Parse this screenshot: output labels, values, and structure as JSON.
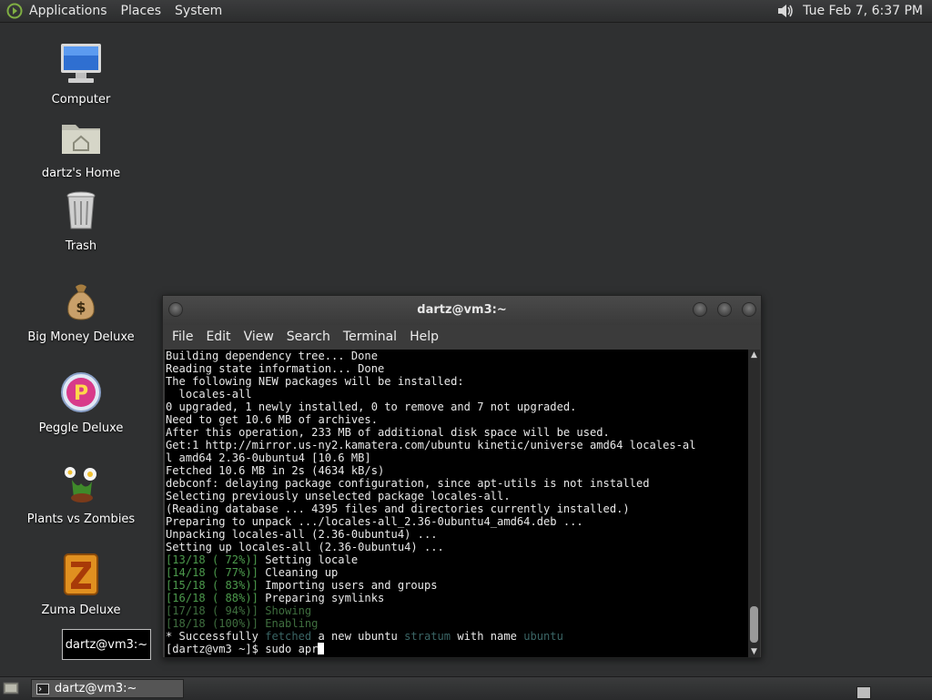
{
  "top_panel": {
    "menus": [
      "Applications",
      "Places",
      "System"
    ],
    "clock": "Tue Feb  7,  6:37 PM"
  },
  "desktop_icons": [
    {
      "label": "Computer",
      "icon": "computer-icon"
    },
    {
      "label": "dartz's Home",
      "icon": "home-folder-icon"
    },
    {
      "label": "Trash",
      "icon": "trash-icon"
    },
    {
      "label": "Big Money Deluxe",
      "icon": "money-bag-icon"
    },
    {
      "label": "Peggle Deluxe",
      "icon": "peggle-icon"
    },
    {
      "label": "Plants vs Zombies",
      "icon": "plants-icon"
    },
    {
      "label": "Zuma Deluxe",
      "icon": "zuma-icon"
    }
  ],
  "tooltip": "dartz@vm3:~",
  "terminal": {
    "title": "dartz@vm3:~",
    "menu": [
      "File",
      "Edit",
      "View",
      "Search",
      "Terminal",
      "Help"
    ],
    "lines": [
      "Building dependency tree... Done",
      "Reading state information... Done",
      "The following NEW packages will be installed:",
      "  locales-all",
      "0 upgraded, 1 newly installed, 0 to remove and 7 not upgraded.",
      "Need to get 10.6 MB of archives.",
      "After this operation, 233 MB of additional disk space will be used.",
      "Get:1 http://mirror.us-ny2.kamatera.com/ubuntu kinetic/universe amd64 locales-al",
      "l amd64 2.36-0ubuntu4 [10.6 MB]",
      "Fetched 10.6 MB in 2s (4634 kB/s)",
      "debconf: delaying package configuration, since apt-utils is not installed",
      "Selecting previously unselected package locales-all.",
      "(Reading database ... 4395 files and directories currently installed.)",
      "Preparing to unpack .../locales-all_2.36-0ubuntu4_amd64.deb ...",
      "Unpacking locales-all (2.36-0ubuntu4) ...",
      "Setting up locales-all (2.36-0ubuntu4) ..."
    ],
    "progress": [
      {
        "prefix": "[13/18 ( 72%)]",
        "text": " Setting locale"
      },
      {
        "prefix": "[14/18 ( 77%)]",
        "text": " Cleaning up"
      },
      {
        "prefix": "[15/18 ( 83%)]",
        "text": " Importing users and groups"
      },
      {
        "prefix": "[16/18 ( 88%)]",
        "text": " Preparing symlinks"
      },
      {
        "prefix": "[17/18 ( 94%)]",
        "text": " Showing"
      },
      {
        "prefix": "[18/18 (100%)]",
        "text": " Enabling"
      }
    ],
    "success_line": {
      "a": "* Successfully ",
      "b": "fetched",
      "c": " a new ubuntu ",
      "d": "stratum",
      "e": " with name ",
      "f": "ubuntu"
    },
    "prompt": "[dartz@vm3 ~]$ ",
    "command": "sudo apr"
  },
  "taskbar": {
    "task_label": "dartz@vm3:~"
  }
}
